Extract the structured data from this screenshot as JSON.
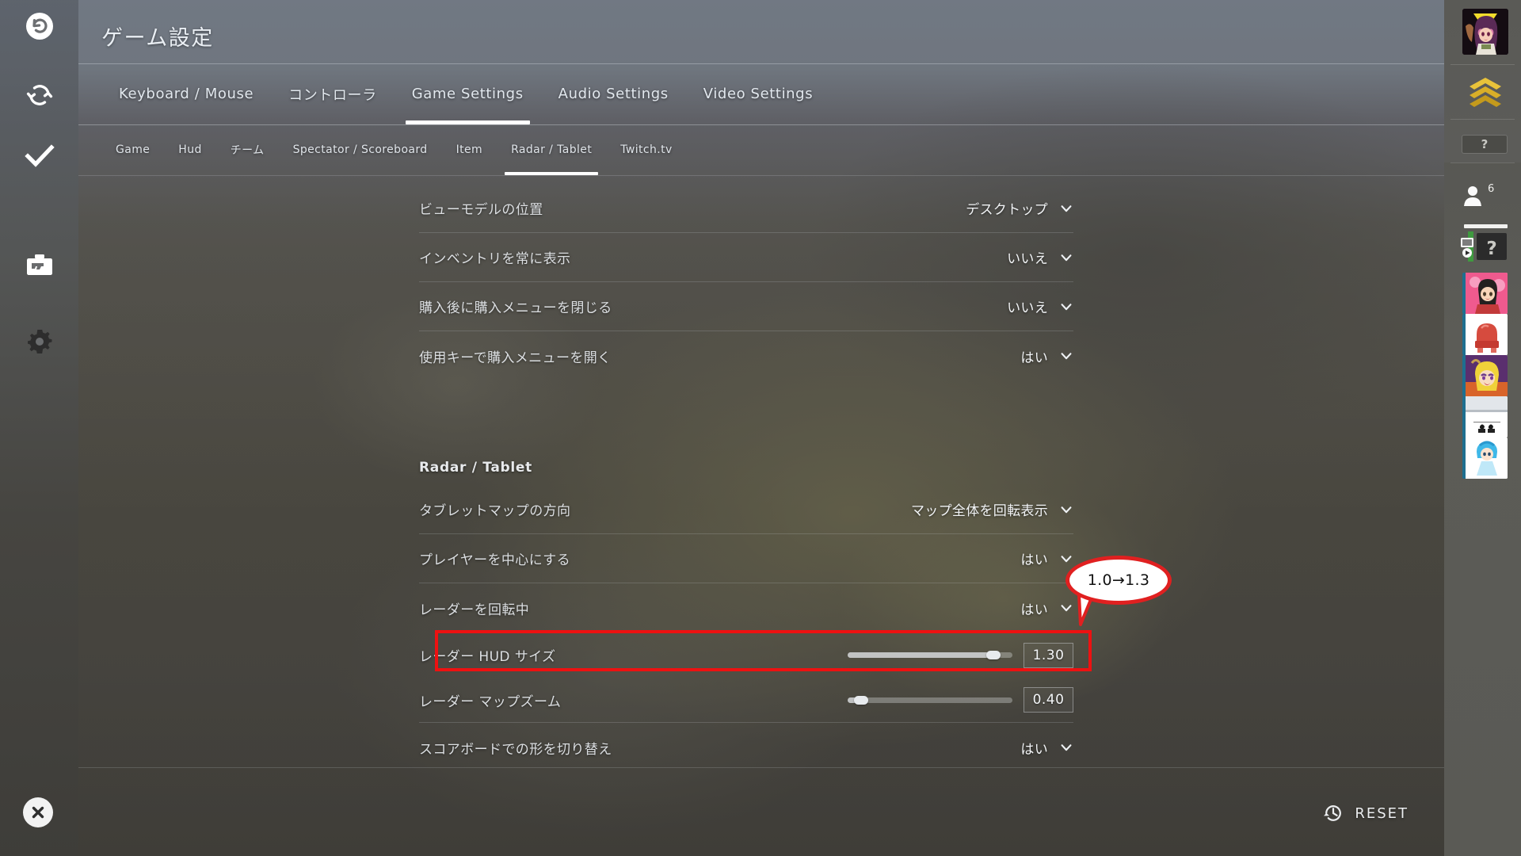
{
  "header": {
    "title": "ゲーム設定"
  },
  "left_rail": {
    "items": [
      {
        "name": "undo-icon",
        "label": "Undo"
      },
      {
        "name": "sync-icon",
        "label": "Sync"
      },
      {
        "name": "check-icon",
        "label": "Apply"
      },
      {
        "name": "loadout-icon",
        "label": "Loadout"
      },
      {
        "name": "gear-icon",
        "label": "Settings"
      }
    ],
    "close_label": "Close"
  },
  "main_tabs": [
    {
      "label": "Keyboard / Mouse",
      "active": false
    },
    {
      "label": "コントローラ",
      "active": false
    },
    {
      "label": "Game Settings",
      "active": true
    },
    {
      "label": "Audio Settings",
      "active": false
    },
    {
      "label": "Video Settings",
      "active": false
    }
  ],
  "sub_tabs": [
    {
      "label": "Game",
      "active": false
    },
    {
      "label": "Hud",
      "active": false
    },
    {
      "label": "チーム",
      "active": false
    },
    {
      "label": "Spectator / Scoreboard",
      "active": false
    },
    {
      "label": "Item",
      "active": false
    },
    {
      "label": "Radar / Tablet",
      "active": true
    },
    {
      "label": "Twitch.tv",
      "active": false
    }
  ],
  "settings": {
    "top_rows": [
      {
        "label": "ビューモデルの位置",
        "value": "デスクトップ",
        "control": "dropdown"
      },
      {
        "label": "インベントリを常に表示",
        "value": "いいえ",
        "control": "dropdown"
      },
      {
        "label": "購入後に購入メニューを閉じる",
        "value": "いいえ",
        "control": "dropdown"
      },
      {
        "label": "使用キーで購入メニューを開く",
        "value": "はい",
        "control": "dropdown"
      }
    ],
    "section_title": "Radar / Tablet",
    "radar_rows": [
      {
        "label": "タブレットマップの方向",
        "value": "マップ全体を回転表示",
        "control": "dropdown"
      },
      {
        "label": "プレイヤーを中心にする",
        "value": "はい",
        "control": "dropdown"
      },
      {
        "label": "レーダーを回転中",
        "value": "はい",
        "control": "dropdown"
      }
    ],
    "slider_rows": [
      {
        "label": "レーダー HUD サイズ",
        "value": "1.30",
        "percent": 92,
        "control": "slider",
        "highlighted": true
      },
      {
        "label": "レーダー マップズーム",
        "value": "0.40",
        "percent": 4,
        "control": "slider",
        "highlighted": false
      }
    ],
    "last_row": {
      "label": "スコアボードでの形を切り替え",
      "value": "はい",
      "control": "dropdown"
    }
  },
  "callout": {
    "text": "1.0→1.3",
    "border_color": "#e02020"
  },
  "highlight": {
    "color": "#ee1111"
  },
  "footer": {
    "reset_label": "RESET",
    "reset_icon": "history-clock-icon"
  },
  "right_rail": {
    "avatar_name": "player-avatar",
    "rank_icon": "rank-chevrons-icon",
    "status_box_text": "?",
    "friends_count": "6",
    "friends_icon": "person-icon",
    "tv_item_text": "?",
    "tv_icon": "twitch-tv-icon",
    "thumbnails": [
      {
        "name": "thumbnail-1"
      },
      {
        "name": "thumbnail-2"
      },
      {
        "name": "thumbnail-3"
      },
      {
        "name": "thumbnail-4"
      },
      {
        "name": "thumbnail-5"
      }
    ]
  },
  "scrollbar": {
    "name": "content-scrollbar"
  }
}
